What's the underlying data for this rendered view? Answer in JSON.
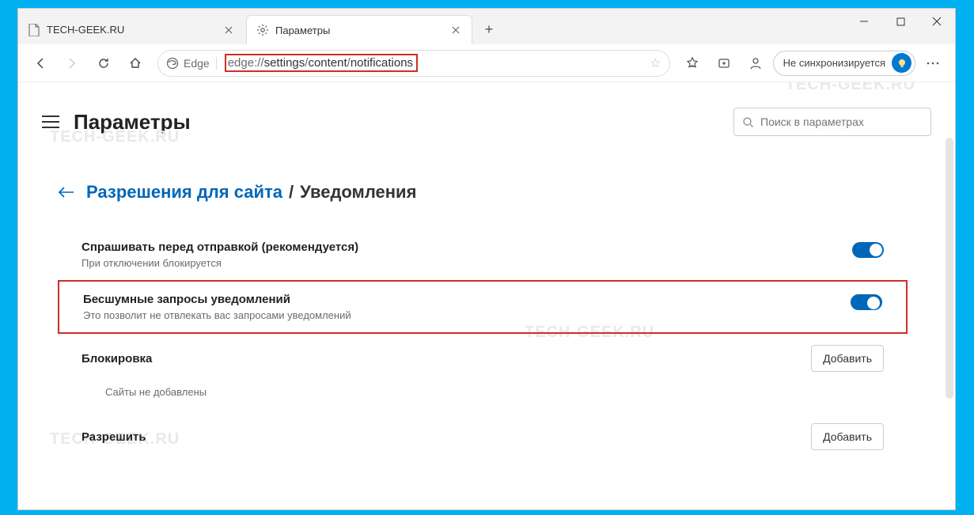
{
  "tabs": {
    "inactive_title": "TECH-GEEK.RU",
    "active_title": "Параметры"
  },
  "address": {
    "badge": "Edge",
    "url_proto": "edge://",
    "url_seg1": "settings",
    "url_sep": "/",
    "url_seg2": "content",
    "url_seg3": "notifications"
  },
  "sync_label": "Не синхронизируется",
  "settings": {
    "title": "Параметры",
    "search_placeholder": "Поиск в параметрах"
  },
  "breadcrumb": {
    "link": "Разрешения для сайта",
    "sep": "/",
    "current": "Уведомления"
  },
  "rows": {
    "ask": {
      "title": "Спрашивать перед отправкой (рекомендуется)",
      "sub": "При отключении блокируется"
    },
    "quiet": {
      "title": "Бесшумные запросы уведомлений",
      "sub": "Это позволит не отвлекать вас запросами уведомлений"
    },
    "block": {
      "title": "Блокировка",
      "empty": "Сайты не добавлены",
      "add": "Добавить"
    },
    "allow": {
      "title": "Разрешить",
      "add": "Добавить"
    }
  },
  "watermark": "TECH-GEEK.RU"
}
